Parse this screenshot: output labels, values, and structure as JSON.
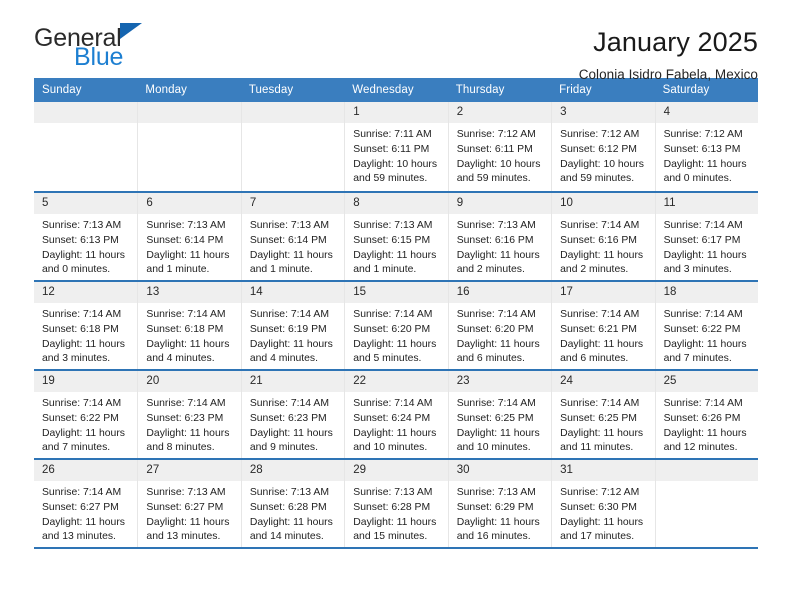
{
  "brand": {
    "name_part1": "General",
    "name_part2": "Blue",
    "mark_icon": "blue-triangle-icon",
    "accent_color": "#1d7fd1"
  },
  "header": {
    "title": "January 2025",
    "subtitle": "Colonia Isidro Fabela, Mexico"
  },
  "theme": {
    "header_blue": "#3a7ebf",
    "rule_blue": "#2e74b5",
    "day_band_gray": "#efefef"
  },
  "weekdays": [
    "Sunday",
    "Monday",
    "Tuesday",
    "Wednesday",
    "Thursday",
    "Friday",
    "Saturday"
  ],
  "weeks": [
    [
      {
        "day": "",
        "empty": true
      },
      {
        "day": "",
        "empty": true
      },
      {
        "day": "",
        "empty": true
      },
      {
        "day": "1",
        "sunrise": "Sunrise: 7:11 AM",
        "sunset": "Sunset: 6:11 PM",
        "daylight1": "Daylight: 10 hours",
        "daylight2": "and 59 minutes."
      },
      {
        "day": "2",
        "sunrise": "Sunrise: 7:12 AM",
        "sunset": "Sunset: 6:11 PM",
        "daylight1": "Daylight: 10 hours",
        "daylight2": "and 59 minutes."
      },
      {
        "day": "3",
        "sunrise": "Sunrise: 7:12 AM",
        "sunset": "Sunset: 6:12 PM",
        "daylight1": "Daylight: 10 hours",
        "daylight2": "and 59 minutes."
      },
      {
        "day": "4",
        "sunrise": "Sunrise: 7:12 AM",
        "sunset": "Sunset: 6:13 PM",
        "daylight1": "Daylight: 11 hours",
        "daylight2": "and 0 minutes."
      }
    ],
    [
      {
        "day": "5",
        "sunrise": "Sunrise: 7:13 AM",
        "sunset": "Sunset: 6:13 PM",
        "daylight1": "Daylight: 11 hours",
        "daylight2": "and 0 minutes."
      },
      {
        "day": "6",
        "sunrise": "Sunrise: 7:13 AM",
        "sunset": "Sunset: 6:14 PM",
        "daylight1": "Daylight: 11 hours",
        "daylight2": "and 1 minute."
      },
      {
        "day": "7",
        "sunrise": "Sunrise: 7:13 AM",
        "sunset": "Sunset: 6:14 PM",
        "daylight1": "Daylight: 11 hours",
        "daylight2": "and 1 minute."
      },
      {
        "day": "8",
        "sunrise": "Sunrise: 7:13 AM",
        "sunset": "Sunset: 6:15 PM",
        "daylight1": "Daylight: 11 hours",
        "daylight2": "and 1 minute."
      },
      {
        "day": "9",
        "sunrise": "Sunrise: 7:13 AM",
        "sunset": "Sunset: 6:16 PM",
        "daylight1": "Daylight: 11 hours",
        "daylight2": "and 2 minutes."
      },
      {
        "day": "10",
        "sunrise": "Sunrise: 7:14 AM",
        "sunset": "Sunset: 6:16 PM",
        "daylight1": "Daylight: 11 hours",
        "daylight2": "and 2 minutes."
      },
      {
        "day": "11",
        "sunrise": "Sunrise: 7:14 AM",
        "sunset": "Sunset: 6:17 PM",
        "daylight1": "Daylight: 11 hours",
        "daylight2": "and 3 minutes."
      }
    ],
    [
      {
        "day": "12",
        "sunrise": "Sunrise: 7:14 AM",
        "sunset": "Sunset: 6:18 PM",
        "daylight1": "Daylight: 11 hours",
        "daylight2": "and 3 minutes."
      },
      {
        "day": "13",
        "sunrise": "Sunrise: 7:14 AM",
        "sunset": "Sunset: 6:18 PM",
        "daylight1": "Daylight: 11 hours",
        "daylight2": "and 4 minutes."
      },
      {
        "day": "14",
        "sunrise": "Sunrise: 7:14 AM",
        "sunset": "Sunset: 6:19 PM",
        "daylight1": "Daylight: 11 hours",
        "daylight2": "and 4 minutes."
      },
      {
        "day": "15",
        "sunrise": "Sunrise: 7:14 AM",
        "sunset": "Sunset: 6:20 PM",
        "daylight1": "Daylight: 11 hours",
        "daylight2": "and 5 minutes."
      },
      {
        "day": "16",
        "sunrise": "Sunrise: 7:14 AM",
        "sunset": "Sunset: 6:20 PM",
        "daylight1": "Daylight: 11 hours",
        "daylight2": "and 6 minutes."
      },
      {
        "day": "17",
        "sunrise": "Sunrise: 7:14 AM",
        "sunset": "Sunset: 6:21 PM",
        "daylight1": "Daylight: 11 hours",
        "daylight2": "and 6 minutes."
      },
      {
        "day": "18",
        "sunrise": "Sunrise: 7:14 AM",
        "sunset": "Sunset: 6:22 PM",
        "daylight1": "Daylight: 11 hours",
        "daylight2": "and 7 minutes."
      }
    ],
    [
      {
        "day": "19",
        "sunrise": "Sunrise: 7:14 AM",
        "sunset": "Sunset: 6:22 PM",
        "daylight1": "Daylight: 11 hours",
        "daylight2": "and 7 minutes."
      },
      {
        "day": "20",
        "sunrise": "Sunrise: 7:14 AM",
        "sunset": "Sunset: 6:23 PM",
        "daylight1": "Daylight: 11 hours",
        "daylight2": "and 8 minutes."
      },
      {
        "day": "21",
        "sunrise": "Sunrise: 7:14 AM",
        "sunset": "Sunset: 6:23 PM",
        "daylight1": "Daylight: 11 hours",
        "daylight2": "and 9 minutes."
      },
      {
        "day": "22",
        "sunrise": "Sunrise: 7:14 AM",
        "sunset": "Sunset: 6:24 PM",
        "daylight1": "Daylight: 11 hours",
        "daylight2": "and 10 minutes."
      },
      {
        "day": "23",
        "sunrise": "Sunrise: 7:14 AM",
        "sunset": "Sunset: 6:25 PM",
        "daylight1": "Daylight: 11 hours",
        "daylight2": "and 10 minutes."
      },
      {
        "day": "24",
        "sunrise": "Sunrise: 7:14 AM",
        "sunset": "Sunset: 6:25 PM",
        "daylight1": "Daylight: 11 hours",
        "daylight2": "and 11 minutes."
      },
      {
        "day": "25",
        "sunrise": "Sunrise: 7:14 AM",
        "sunset": "Sunset: 6:26 PM",
        "daylight1": "Daylight: 11 hours",
        "daylight2": "and 12 minutes."
      }
    ],
    [
      {
        "day": "26",
        "sunrise": "Sunrise: 7:14 AM",
        "sunset": "Sunset: 6:27 PM",
        "daylight1": "Daylight: 11 hours",
        "daylight2": "and 13 minutes."
      },
      {
        "day": "27",
        "sunrise": "Sunrise: 7:13 AM",
        "sunset": "Sunset: 6:27 PM",
        "daylight1": "Daylight: 11 hours",
        "daylight2": "and 13 minutes."
      },
      {
        "day": "28",
        "sunrise": "Sunrise: 7:13 AM",
        "sunset": "Sunset: 6:28 PM",
        "daylight1": "Daylight: 11 hours",
        "daylight2": "and 14 minutes."
      },
      {
        "day": "29",
        "sunrise": "Sunrise: 7:13 AM",
        "sunset": "Sunset: 6:28 PM",
        "daylight1": "Daylight: 11 hours",
        "daylight2": "and 15 minutes."
      },
      {
        "day": "30",
        "sunrise": "Sunrise: 7:13 AM",
        "sunset": "Sunset: 6:29 PM",
        "daylight1": "Daylight: 11 hours",
        "daylight2": "and 16 minutes."
      },
      {
        "day": "31",
        "sunrise": "Sunrise: 7:12 AM",
        "sunset": "Sunset: 6:30 PM",
        "daylight1": "Daylight: 11 hours",
        "daylight2": "and 17 minutes."
      },
      {
        "day": "",
        "empty": true
      }
    ]
  ]
}
